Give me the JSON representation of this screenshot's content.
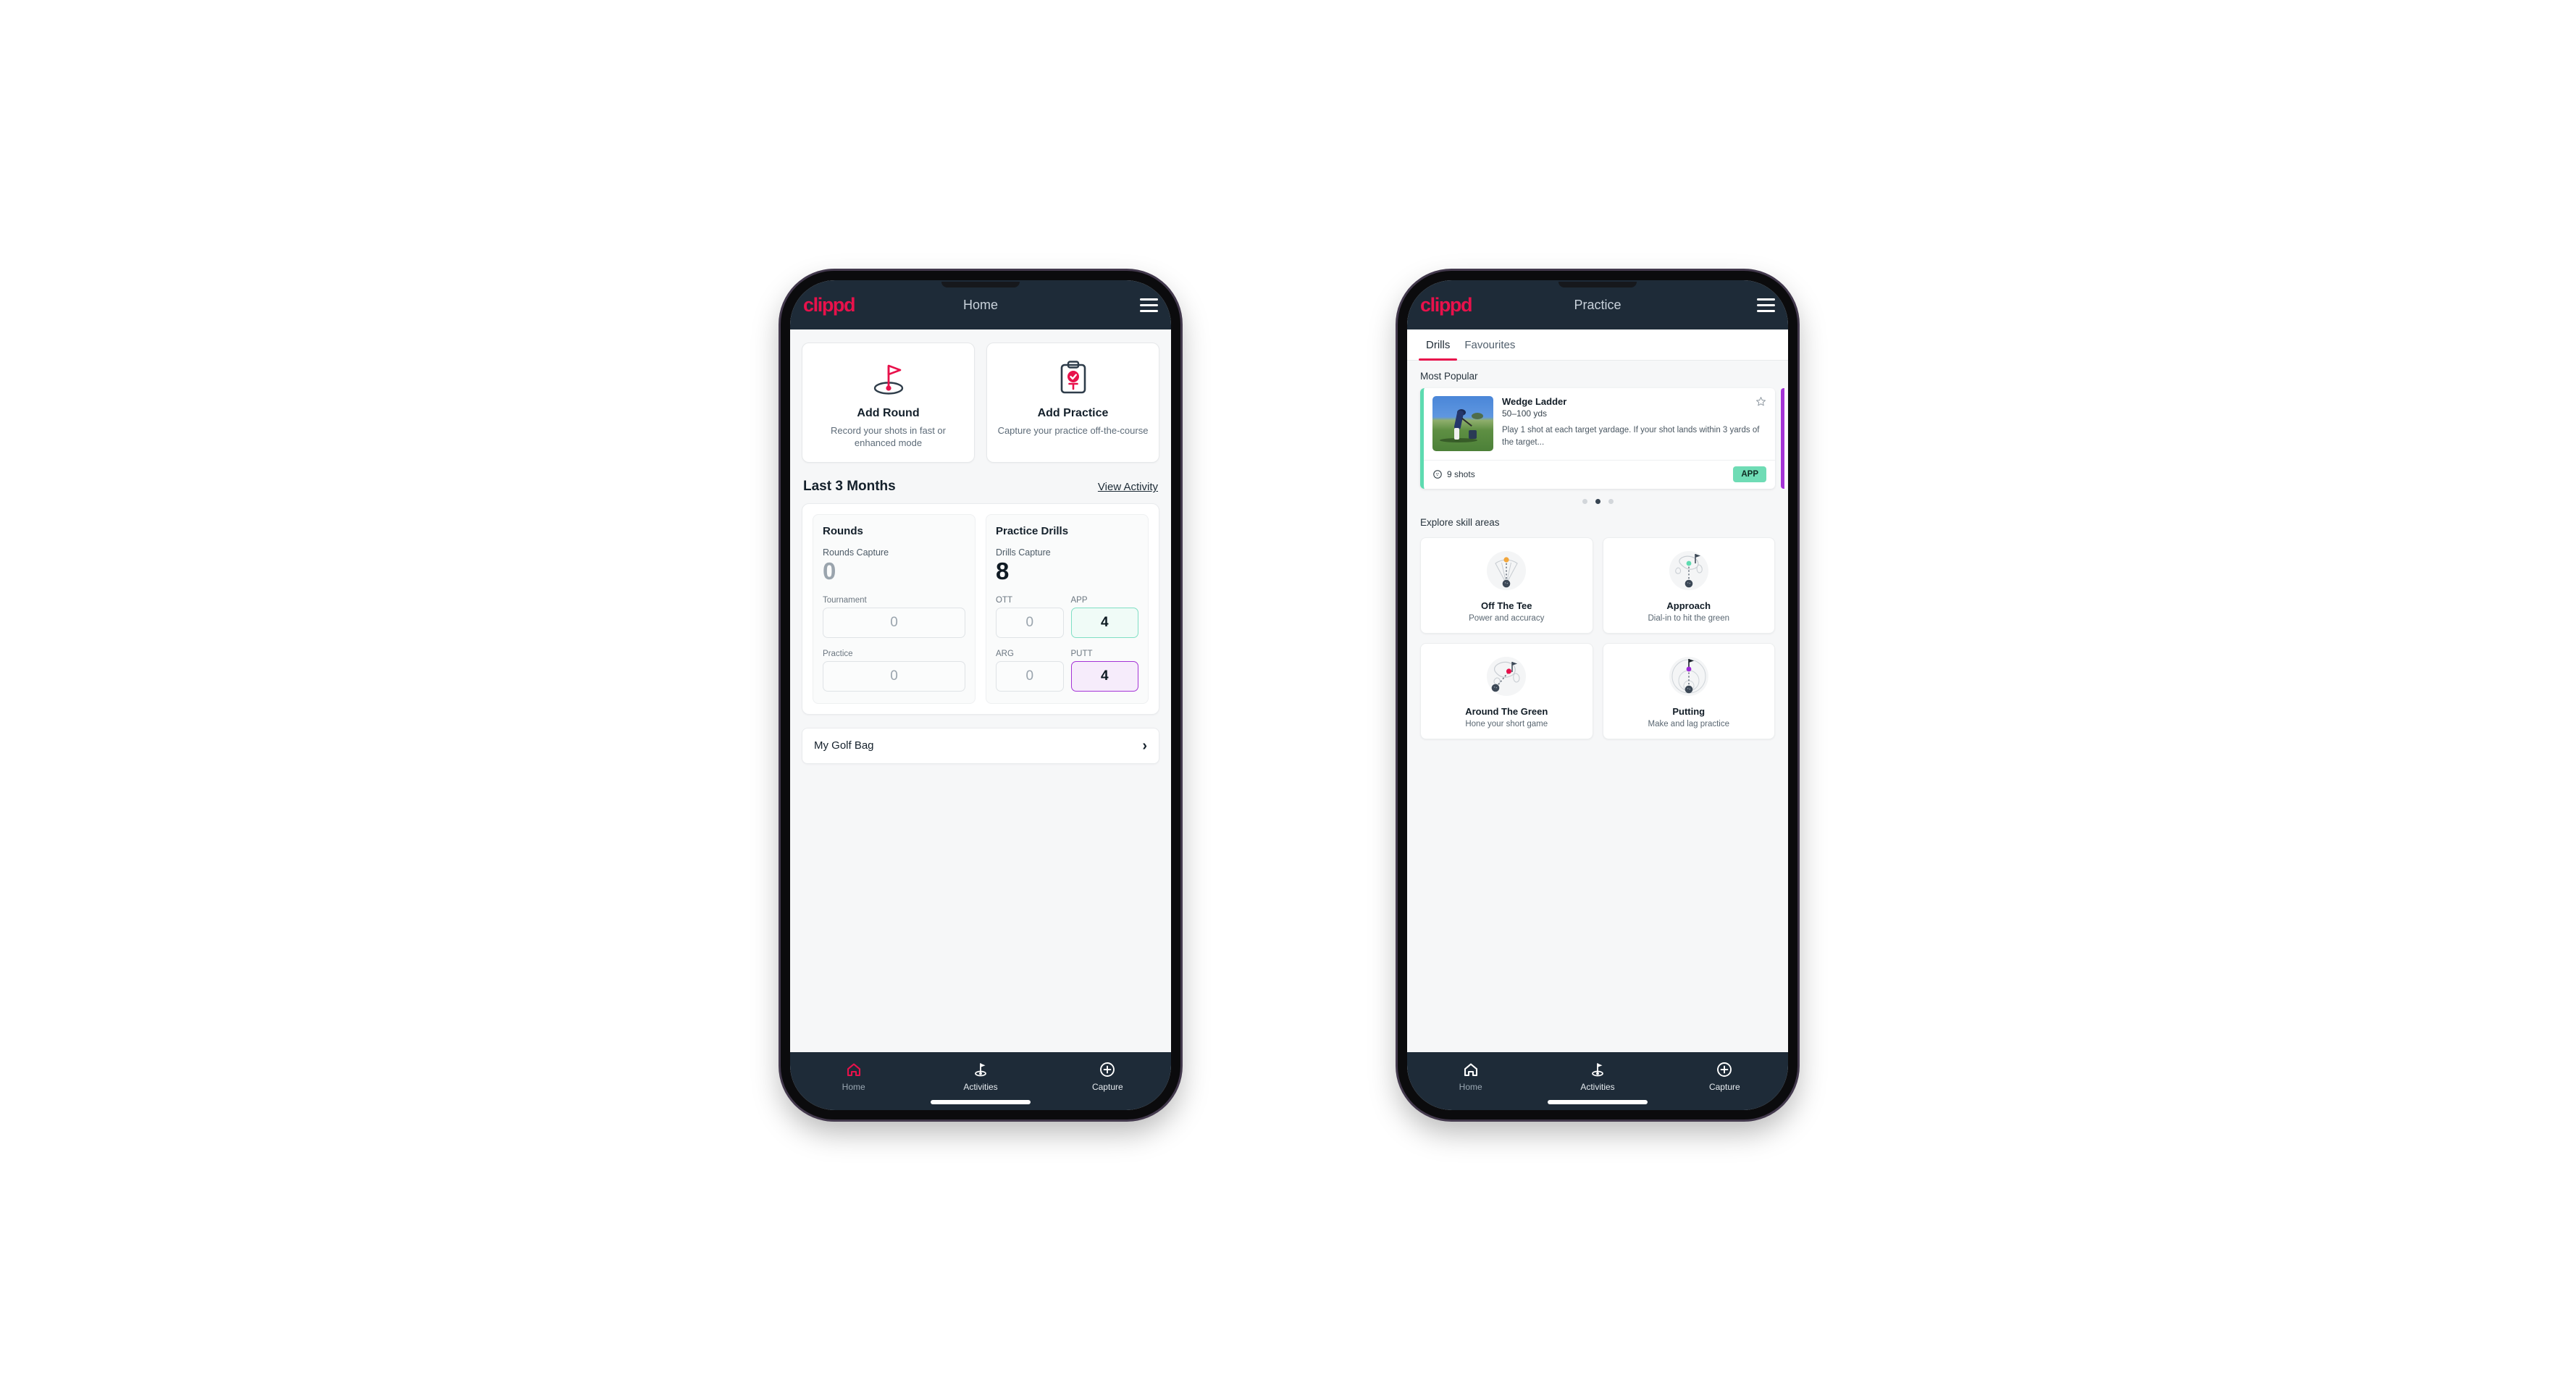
{
  "brand": {
    "logo_text": "clippd",
    "accent_pink": "#e8114b",
    "navy": "#1e2b38",
    "green": "#6fdcb5",
    "purple": "#a433d6"
  },
  "phone1": {
    "appbar": {
      "title": "Home",
      "menu_icon": "hamburger-icon"
    },
    "quick_actions": [
      {
        "icon": "golf-flag-hole-icon",
        "title": "Add Round",
        "subtitle": "Record your shots in fast or enhanced mode"
      },
      {
        "icon": "clipboard-check-tee-icon",
        "title": "Add Practice",
        "subtitle": "Capture your practice off-the-course"
      }
    ],
    "section": {
      "title": "Last 3 Months",
      "link": "View Activity"
    },
    "rounds": {
      "heading": "Rounds",
      "capture_label": "Rounds Capture",
      "capture_value": "0",
      "fields": [
        {
          "label": "Tournament",
          "value": "0",
          "state": "empty"
        },
        {
          "label": "Practice",
          "value": "0",
          "state": "empty"
        }
      ]
    },
    "drills": {
      "heading": "Practice Drills",
      "capture_label": "Drills Capture",
      "capture_value": "8",
      "fields": [
        {
          "label": "OTT",
          "value": "0",
          "state": "empty"
        },
        {
          "label": "APP",
          "value": "4",
          "state": "app"
        },
        {
          "label": "ARG",
          "value": "0",
          "state": "empty"
        },
        {
          "label": "PUTT",
          "value": "4",
          "state": "putt"
        }
      ]
    },
    "bag": {
      "label": "My Golf Bag",
      "chevron": "chevron-right-icon"
    },
    "nav": [
      {
        "icon": "home-icon",
        "label": "Home",
        "active": true
      },
      {
        "icon": "golf-flag-icon",
        "label": "Activities",
        "active": false
      },
      {
        "icon": "plus-circle-icon",
        "label": "Capture",
        "active": false
      }
    ]
  },
  "phone2": {
    "appbar": {
      "title": "Practice",
      "menu_icon": "hamburger-icon"
    },
    "tabs": [
      {
        "label": "Drills",
        "active": true
      },
      {
        "label": "Favourites",
        "active": false
      }
    ],
    "most_popular": {
      "title": "Most Popular"
    },
    "drill": {
      "name": "Wedge Ladder",
      "yardage": "50–100 yds",
      "description": "Play 1 shot at each target yardage. If your shot lands within 3 yards of the target...",
      "shots": "9 shots",
      "shots_icon": "golf-ball-icon",
      "badge": "APP",
      "favourite_icon": "star-outline-icon",
      "thumbnail": "golfer-chipping-photo",
      "accent_color": "#5ddbb0"
    },
    "carousel": {
      "dots": 3,
      "active_index": 1
    },
    "skills_section": {
      "title": "Explore skill areas"
    },
    "skills": [
      {
        "icon": "tee-shot-dispersion-icon",
        "name": "Off The Tee",
        "subtitle": "Power and accuracy",
        "dot_color": "#f2a63b"
      },
      {
        "icon": "green-approach-icon",
        "name": "Approach",
        "subtitle": "Dial-in to hit the green",
        "dot_color": "#5ddbb0"
      },
      {
        "icon": "chip-to-green-icon",
        "name": "Around The Green",
        "subtitle": "Hone your short game",
        "dot_color": "#e8114b"
      },
      {
        "icon": "putting-rings-icon",
        "name": "Putting",
        "subtitle": "Make and lag practice",
        "dot_color": "#9c27d6"
      }
    ],
    "nav": [
      {
        "icon": "home-icon",
        "label": "Home",
        "active": false
      },
      {
        "icon": "golf-flag-icon",
        "label": "Activities",
        "active": false
      },
      {
        "icon": "plus-circle-icon",
        "label": "Capture",
        "active": false
      }
    ]
  }
}
